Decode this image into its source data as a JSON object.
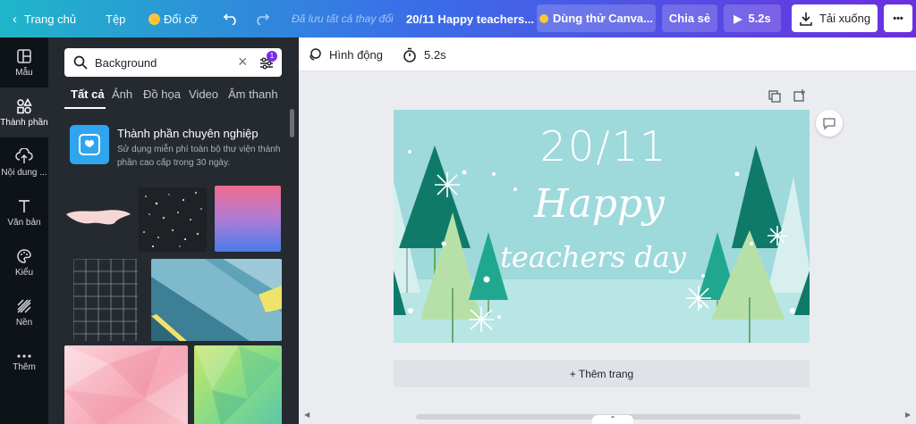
{
  "topbar": {
    "home": "Trang chủ",
    "file": "Tệp",
    "resize": "Đổi cỡ",
    "saved_status": "Đã lưu tất cả thay đổi",
    "doc_title": "20/11 Happy teachers...",
    "trial": "Dùng thử Canva...",
    "share": "Chia sẻ",
    "play_duration": "5.2s",
    "download": "Tải xuống",
    "more": "•••"
  },
  "rail": {
    "items": [
      {
        "label": "Mẫu",
        "icon": "layout-icon"
      },
      {
        "label": "Thành phần",
        "icon": "shapes-icon"
      },
      {
        "label": "Nội dung ...",
        "icon": "upload-cloud-icon"
      },
      {
        "label": "Văn bản",
        "icon": "text-icon"
      },
      {
        "label": "Kiểu",
        "icon": "palette-icon"
      },
      {
        "label": "Nền",
        "icon": "background-pattern-icon"
      },
      {
        "label": "Thêm",
        "icon": "more-dots-icon"
      }
    ]
  },
  "panel": {
    "search_value": "Background",
    "filter_badge": "1",
    "tabs": [
      "Tất cả",
      "Ảnh",
      "Đồ họa",
      "Video",
      "Âm thanh"
    ],
    "pro_title": "Thành phần chuyên nghiệp",
    "pro_desc_line1": "Sử dụng miễn phí toàn bộ thư viện thành",
    "pro_desc_line2": "phần cao cấp trong 30 ngày."
  },
  "toolbar2": {
    "animate": "Hình động",
    "duration": "5.2s"
  },
  "canvas": {
    "line1": "20/11",
    "line2": "Happy",
    "line3": "teachers day"
  },
  "add_page": "+ Thêm trang",
  "colors": {
    "canvas_bg": "#9ed9dc",
    "tree_dark": "#0f7a6a",
    "tree_teal": "#1fa88f",
    "tree_light": "#b7e0a9",
    "accent_purple": "#7d2ae8"
  }
}
